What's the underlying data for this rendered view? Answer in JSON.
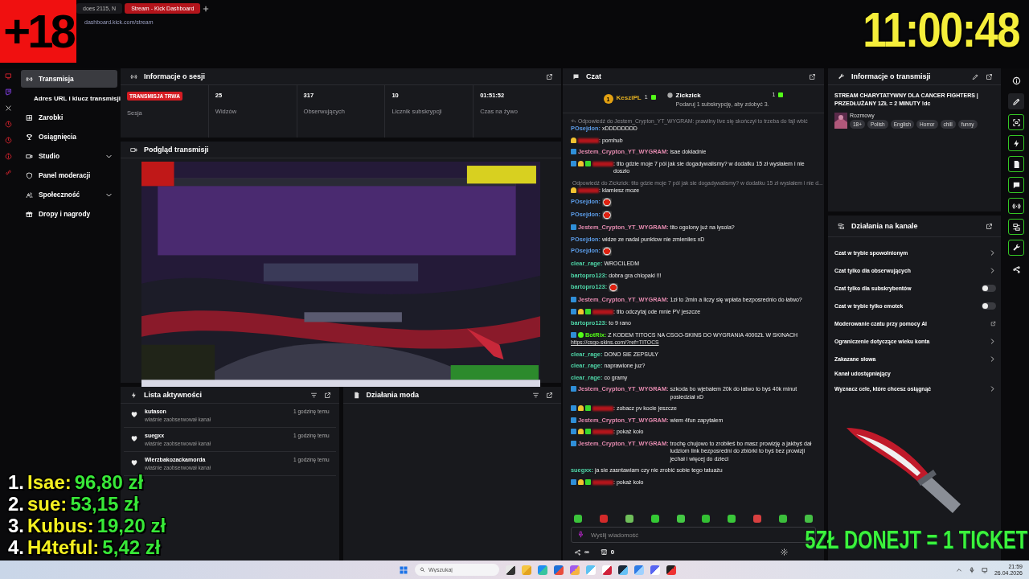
{
  "browser": {
    "tabs": [
      {
        "label": "does 2115, N",
        "selected": false
      },
      {
        "label": "Stream - Kick Dashboard",
        "selected": true
      }
    ],
    "url": "dashboard.kick.com/stream"
  },
  "overlay_badge": "+18",
  "overlay_clock": "11:00:48",
  "sidebar": {
    "items": [
      {
        "label": "Transmisja",
        "selected": true,
        "sub": false
      },
      {
        "label": "Adres URL i klucz transmisji",
        "selected": false,
        "sub": true
      },
      {
        "label": "Zarobki",
        "selected": false,
        "sub": false
      },
      {
        "label": "Osiągnięcia",
        "selected": false,
        "sub": false
      },
      {
        "label": "Studio",
        "selected": false,
        "sub": false,
        "expanded": false
      },
      {
        "label": "Panel moderacji",
        "selected": false,
        "sub": false
      },
      {
        "label": "Społeczność",
        "selected": false,
        "sub": false,
        "expanded": false
      },
      {
        "label": "Dropy i nagrody",
        "selected": false,
        "sub": false
      }
    ]
  },
  "session": {
    "title": "Informacje o sesji",
    "live_badge": "TRANSMISJA TRWA",
    "live_label": "Sesja",
    "stats": [
      {
        "value": "25",
        "label": "Widzów"
      },
      {
        "value": "317",
        "label": "Obserwujących"
      },
      {
        "value": "10",
        "label": "Licznik subskrypcji"
      },
      {
        "value": "01:51:52",
        "label": "Czas na żywo"
      }
    ]
  },
  "preview": {
    "title": "Podgląd transmisji"
  },
  "activity": {
    "title": "Lista aktywności",
    "items": [
      {
        "user": "kutason",
        "action": "właśnie zaobserwował kanał",
        "time": "1 godzinę temu"
      },
      {
        "user": "suegxx",
        "action": "właśnie zaobserwował kanał",
        "time": "1 godzinę temu"
      },
      {
        "user": "Wierzbakozackamorda",
        "action": "właśnie zaobserwował kanał",
        "time": "1 godzinę temu"
      }
    ]
  },
  "mod_actions": {
    "title": "Działania moda"
  },
  "chat": {
    "title": "Czat",
    "gifters": [
      {
        "rank": "1",
        "name": "KesziPL",
        "count": "1"
      },
      {
        "name": "Zickzick",
        "count": "1",
        "hint": "Podaruj 1 subskrypcję, aby zdobyć 3."
      }
    ],
    "messages": [
      {
        "reply": "Odpowiedź do Jestem_Crypton_YT_WYGRAM: prawilny live się skończył to trzeba do fajl wbić",
        "user": "POsejdon:",
        "color": "#5b9be6",
        "text": "xDDDDDDDD"
      },
      {
        "name_hidden": true,
        "badges": [
          {
            "kind": "cake"
          }
        ],
        "text": ": pornhub"
      },
      {
        "user": "Jestem_Crypton_YT_WYGRAM:",
        "color": "#e58bb0",
        "badges": [
          {
            "kind": "mod"
          }
        ],
        "text": "isae dokładnie"
      },
      {
        "name_hidden": true,
        "badges": [
          {
            "kind": "mod"
          },
          {
            "kind": "cake"
          },
          {
            "kind": "sub"
          }
        ],
        "text": ": tito gdzie moje 7 pól jak sie dogadywalismy? w dodatku 15 zł wysłałem i nie doszło"
      },
      {
        "reply": "Odpowiedź do Zickzick: tito gdzie moje 7 pól jak sie dogadywalismy? w dodatku 15 zł wysłałem i nie d...",
        "name_hidden": true,
        "badges": [
          {
            "kind": "cake"
          }
        ],
        "text": ": klamiesz moze"
      },
      {
        "user": "POsejdon:",
        "color": "#5b9be6",
        "emote": true
      },
      {
        "user": "POsejdon:",
        "color": "#5b9be6",
        "emote": true
      },
      {
        "user": "Jestem_Crypton_YT_WYGRAM:",
        "color": "#e58bb0",
        "badges": [
          {
            "kind": "mod"
          }
        ],
        "text": "tito ogolony już na łysola?"
      },
      {
        "user": "POsejdon:",
        "color": "#5b9be6",
        "text": "widze ze nadal punktow nie zmieniles xD"
      },
      {
        "user": "POsejdon:",
        "color": "#5b9be6",
        "emote": true
      },
      {
        "user": "clear_rage:",
        "color": "#4fd6a8",
        "text": "WROCILEDM"
      },
      {
        "user": "bartopro123:",
        "color": "#4fd6a8",
        "text": "dobra gra chlopaki !!!"
      },
      {
        "user": "bartopro123:",
        "color": "#4fd6a8",
        "emote": true
      },
      {
        "user": "Jestem_Crypton_YT_WYGRAM:",
        "color": "#e58bb0",
        "badges": [
          {
            "kind": "mod"
          }
        ],
        "text": "1zł to 2min a liczy się wpłata bezposrednio do łatwo?"
      },
      {
        "name_hidden": true,
        "badges": [
          {
            "kind": "mod"
          },
          {
            "kind": "cake"
          },
          {
            "kind": "sub"
          }
        ],
        "text": ": tito odczytaj ode mnie PV jeszcze"
      },
      {
        "user": "bartopro123:",
        "color": "#4fd6a8",
        "text": "to 9 rano"
      },
      {
        "user": "BotRix:",
        "color": "#53fc18",
        "badges": [
          {
            "kind": "mod"
          },
          {
            "kind": "verified"
          }
        ],
        "text": "Z KODEM TITOCS NA CSGO-SKINS DO WYGRANIA 4000ZŁ W SKINACH",
        "link": "https://csgo-skins.com/?ref=TITOCS"
      },
      {
        "user": "clear_rage:",
        "color": "#4fd6a8",
        "text": "DONO SIE ZEPSULY"
      },
      {
        "user": "clear_rage:",
        "color": "#4fd6a8",
        "text": "naprawione juz?"
      },
      {
        "user": "clear_rage:",
        "color": "#4fd6a8",
        "text": "co gramy"
      },
      {
        "user": "Jestem_Crypton_YT_WYGRAM:",
        "color": "#e58bb0",
        "badges": [
          {
            "kind": "mod"
          }
        ],
        "text": "szkoda bo wjebałem 20k do łatwo to byś 40k minut posiedział xD"
      },
      {
        "name_hidden": true,
        "badges": [
          {
            "kind": "mod"
          },
          {
            "kind": "cake"
          },
          {
            "kind": "sub"
          }
        ],
        "text": ": zobacz pv kocie jeszcze"
      },
      {
        "user": "Jestem_Crypton_YT_WYGRAM:",
        "color": "#e58bb0",
        "badges": [
          {
            "kind": "mod"
          }
        ],
        "text": "wiem 4fun zapytałem"
      },
      {
        "name_hidden": true,
        "badges": [
          {
            "kind": "mod"
          },
          {
            "kind": "cake"
          },
          {
            "kind": "sub"
          }
        ],
        "text": ": pokaż koło"
      },
      {
        "user": "Jestem_Crypton_YT_WYGRAM:",
        "color": "#e58bb0",
        "badges": [
          {
            "kind": "mod"
          }
        ],
        "text": "trochę chujowo to zrobiłeś bo masz prowizję a jakbyś dał ludziom link bezposredni do zbiórki to byś bez prowizji jechał i więcej do dzieci"
      },
      {
        "user": "suegxx:",
        "color": "#4fd6a8",
        "text": "ja sie zasntawiam czy nie zrobić sobie tego tatuażu"
      },
      {
        "name_hidden": true,
        "badges": [
          {
            "kind": "mod"
          },
          {
            "kind": "cake"
          },
          {
            "kind": "sub"
          }
        ],
        "text": ": pokaż koło"
      }
    ],
    "input": {
      "placeholder": "Wyślij wiadomość"
    },
    "footer": {
      "points": "∞",
      "store": "0"
    }
  },
  "stream_info": {
    "title": "Informacje o transmisji",
    "stream_title": "STREAM CHARYTATYWNY DLA CANCER FIGHTERS | PRZEDŁUŻANY 1ZŁ = 2 MINUTY !dc",
    "category": "Rozmowy",
    "tags": [
      "18+",
      "Polish",
      "English",
      "Horror",
      "chill",
      "funny"
    ]
  },
  "channel_actions": {
    "title": "Działania na kanale",
    "items": [
      {
        "label": "Czat w trybie spowolnionym",
        "kind": "chevron"
      },
      {
        "label": "Czat tylko dla obserwujących",
        "kind": "chevron"
      },
      {
        "label": "Czat tylko dla subskrybentów",
        "kind": "toggle",
        "on": false
      },
      {
        "label": "Czat w trybie tylko emotek",
        "kind": "toggle",
        "on": false
      },
      {
        "label": "Moderowanie czatu przy pomocy AI",
        "kind": "external"
      },
      {
        "label": "Ograniczenie dotyczące wieku konta",
        "kind": "chevron"
      },
      {
        "label": "Zakazane słowa",
        "kind": "chevron"
      },
      {
        "label": "Kanał udostępniający",
        "kind": "plain"
      },
      {
        "label": "Wyznacz cele, które chcesz osiągnąć",
        "kind": "chevron"
      }
    ]
  },
  "right_rail": [
    {
      "active": false
    },
    {
      "active": false
    },
    {
      "active": true
    },
    {
      "active": true
    },
    {
      "active": true
    },
    {
      "active": true
    },
    {
      "active": true
    },
    {
      "active": true
    },
    {
      "active": true
    },
    {
      "active": false
    }
  ],
  "leaderboard": [
    {
      "rank": "1.",
      "name": "Isae:",
      "amount": "96,80 zł"
    },
    {
      "rank": "2.",
      "name": "sue:",
      "amount": "53,15 zł"
    },
    {
      "rank": "3.",
      "name": "Kubus:",
      "amount": "19,20 zł"
    },
    {
      "rank": "4.",
      "name": "H4teful:",
      "amount": "5,42 zł"
    }
  ],
  "donation_banner": "5ZŁ DONEJT = 1 TICKET",
  "taskbar": {
    "search": {
      "placeholder": "Wyszukaj"
    },
    "time": "21:59",
    "date": "26.04.2026"
  }
}
